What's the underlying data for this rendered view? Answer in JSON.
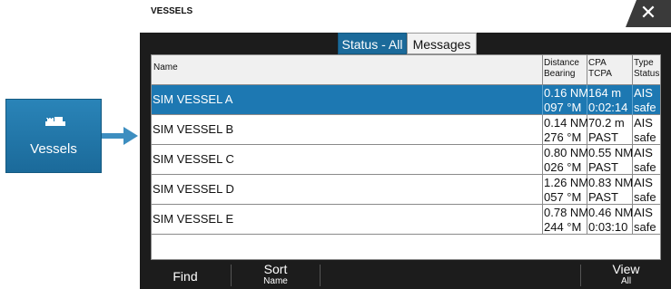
{
  "tile": {
    "label": "Vessels",
    "icon": "ship-icon"
  },
  "panel": {
    "title": "VESSELS",
    "close_label": "✕",
    "tabs": [
      {
        "label": "Status - All",
        "active": true
      },
      {
        "label": "Messages",
        "active": false
      }
    ]
  },
  "table": {
    "headers": {
      "name": "Name",
      "dist": [
        "Distance",
        "Bearing"
      ],
      "cpa": [
        "CPA",
        "TCPA"
      ],
      "type": [
        "Type",
        "Status"
      ]
    },
    "rows": [
      {
        "name": "SIM VESSEL A",
        "distance": "0.16 NM",
        "bearing": "097 °M",
        "cpa": "164 m",
        "tcpa": "0:02:14",
        "type": "AIS",
        "status": "safe",
        "selected": true
      },
      {
        "name": "SIM VESSEL B",
        "distance": "0.14 NM",
        "bearing": "276 °M",
        "cpa": "70.2 m",
        "tcpa": "PAST",
        "type": "AIS",
        "status": "safe",
        "selected": false
      },
      {
        "name": "SIM VESSEL C",
        "distance": "0.80 NM",
        "bearing": "026 °M",
        "cpa": "0.55 NM",
        "tcpa": "PAST",
        "type": "AIS",
        "status": "safe",
        "selected": false
      },
      {
        "name": "SIM VESSEL D",
        "distance": "1.26 NM",
        "bearing": "057 °M",
        "cpa": "0.83 NM",
        "tcpa": "PAST",
        "type": "AIS",
        "status": "safe",
        "selected": false
      },
      {
        "name": "SIM VESSEL E",
        "distance": "0.78 NM",
        "bearing": "244 °M",
        "cpa": "0.46 NM",
        "tcpa": "0:03:10",
        "type": "AIS",
        "status": "safe",
        "selected": false
      }
    ]
  },
  "toolbar": {
    "find": "Find",
    "sort": "Sort",
    "sort_sub": "Name",
    "view": "View",
    "view_sub": "All"
  },
  "colors": {
    "accent": "#1d78b2",
    "panel_bg": "#1c1c1c"
  }
}
